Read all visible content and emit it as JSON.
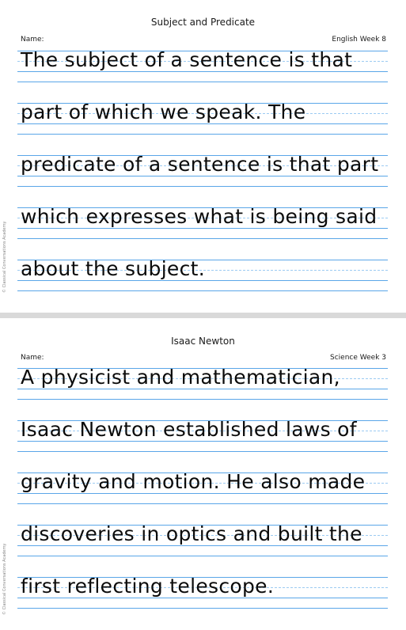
{
  "sheets": [
    {
      "title": "Subject and Predicate",
      "name_label": "Name:",
      "week": "English Week 8",
      "copyright": "© Classical Conversations Academy",
      "lines": [
        "The subject of a sentence is that",
        "part of which we speak. The",
        "predicate of a sentence is that part",
        "which expresses what is being said",
        "about the subject."
      ]
    },
    {
      "title": "Isaac Newton",
      "name_label": "Name:",
      "week": "Science Week 3",
      "copyright": "© Classical Conversations Academy",
      "lines": [
        "A physicist and mathematician,",
        "Isaac Newton established laws of",
        "gravity and motion. He also made",
        "discoveries in optics and built the",
        "first reflecting telescope."
      ]
    }
  ]
}
